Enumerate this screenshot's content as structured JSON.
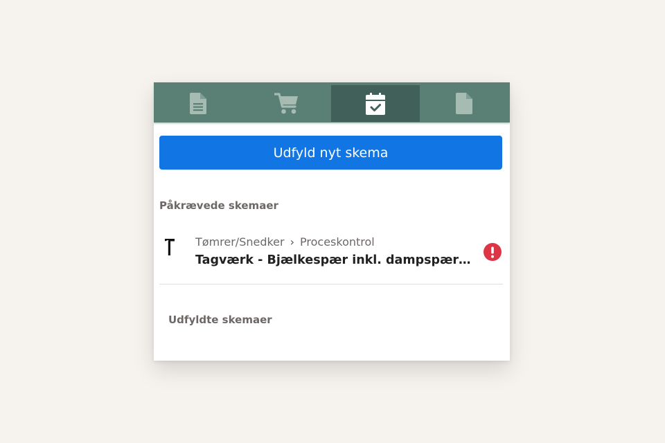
{
  "tabs": [
    {
      "id": "documents",
      "icon": "document-lines-icon",
      "active": false
    },
    {
      "id": "shop",
      "icon": "shopping-cart-icon",
      "active": false
    },
    {
      "id": "schemas",
      "icon": "calendar-check-icon",
      "active": true
    },
    {
      "id": "files",
      "icon": "blank-file-icon",
      "active": false
    }
  ],
  "new_schema_button": "Udfyld nyt skema",
  "required_section": {
    "label": "Påkrævede skemaer",
    "items": [
      {
        "icon": "hammer-icon",
        "trade": "Tømrer/Snedker",
        "separator": "›",
        "category": "Proceskontrol",
        "title": "Tagværk - Bjælkespær inkl. dampspærre, isolering og undertag",
        "status_icon": "exclamation-circle-icon",
        "status_color": "#dc3545"
      }
    ]
  },
  "filled_section": {
    "label": "Udfyldte skemaer"
  },
  "colors": {
    "tabbar": "#5a7f75",
    "tab_active": "#41605a",
    "primary": "#1176e3",
    "background": "#f6f2ee"
  }
}
